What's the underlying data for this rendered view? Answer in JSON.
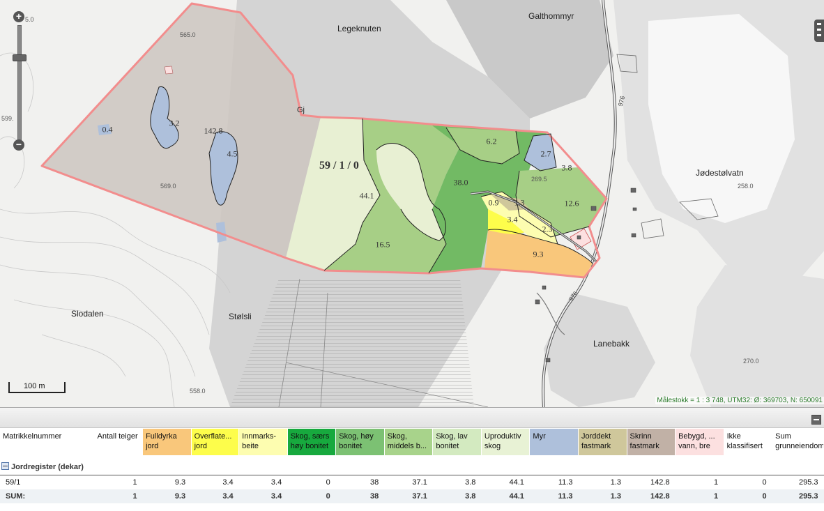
{
  "map": {
    "place_labels": {
      "legeknuten": "Legeknuten",
      "galthommyr": "Galthommyr",
      "jodestolvatn": "Jødestølvatn",
      "slodalen": "Slodalen",
      "stolsli": "Stølsli",
      "lanebakk": "Lanebakk",
      "gj": "Gj"
    },
    "elevations": {
      "e565": "565.0",
      "e569": "569.0",
      "e258": "258.0",
      "e270": "270.0",
      "e558": "558.0",
      "e269": "269.5",
      "edge_top": "5.0",
      "edge_left": "599."
    },
    "parcel_label": "59 / 1 / 0",
    "area_labels": {
      "a04": "0.4",
      "a32": "3.2",
      "a1428": "142.8",
      "a45": "4.5",
      "a441": "44.1",
      "a165": "16.5",
      "a380": "38.0",
      "a62": "6.2",
      "a27": "2.7",
      "a38": "3.8",
      "a126": "12.6",
      "a09": "0.9",
      "a13": "1.3",
      "a34": "3.4",
      "a23": "2.3",
      "a93": "9.3"
    },
    "road_labels": {
      "r1": "976",
      "r2": "976"
    },
    "scale_label": "100 m",
    "status_line": "Målestokk = 1 : 3 748, UTM32: Ø: 369703, N: 650091"
  },
  "zoom": {
    "plus": "+",
    "minus": "−"
  },
  "table": {
    "columns": [
      {
        "label": "Matrikkelnummer",
        "color": "#ffffff"
      },
      {
        "label": "Antall teiger",
        "color": "#ffffff"
      },
      {
        "label": "Fulldyrka jord",
        "color": "#f9c77b"
      },
      {
        "label": "Overflate... jord",
        "color": "#fdfd4b"
      },
      {
        "label": "Innmarks-beite",
        "color": "#fdfdb0"
      },
      {
        "label": "Skog, særs høy bonitet",
        "color": "#17a93e"
      },
      {
        "label": "Skog, høy bonitet",
        "color": "#7cc173"
      },
      {
        "label": "Skog, middels b...",
        "color": "#a8d38b"
      },
      {
        "label": "Skog, lav bonitet",
        "color": "#d3eac0"
      },
      {
        "label": "Uproduktiv skog",
        "color": "#e8f2d5"
      },
      {
        "label": "Myr",
        "color": "#aec0db"
      },
      {
        "label": "Jorddekt fastmark",
        "color": "#cfc79b"
      },
      {
        "label": "Skrinn fastmark",
        "color": "#c1b1a6"
      },
      {
        "label": "Bebygd, ... vann, bre",
        "color": "#fce0e0"
      },
      {
        "label": "Ikke klassifisert",
        "color": "#ffffff"
      },
      {
        "label": "Sum grunneiendom",
        "color": "#ffffff"
      }
    ],
    "group_label": "Jordregister (dekar)",
    "rows": [
      [
        "59/1",
        "1",
        "9.3",
        "3.4",
        "3.4",
        "0",
        "38",
        "37.1",
        "3.8",
        "44.1",
        "11.3",
        "1.3",
        "142.8",
        "1",
        "0",
        "295.3"
      ]
    ],
    "sum_row": [
      "SUM:",
      "1",
      "9.3",
      "3.4",
      "3.4",
      "0",
      "38",
      "37.1",
      "3.8",
      "44.1",
      "11.3",
      "1.3",
      "142.8",
      "1",
      "0",
      "295.3"
    ]
  }
}
